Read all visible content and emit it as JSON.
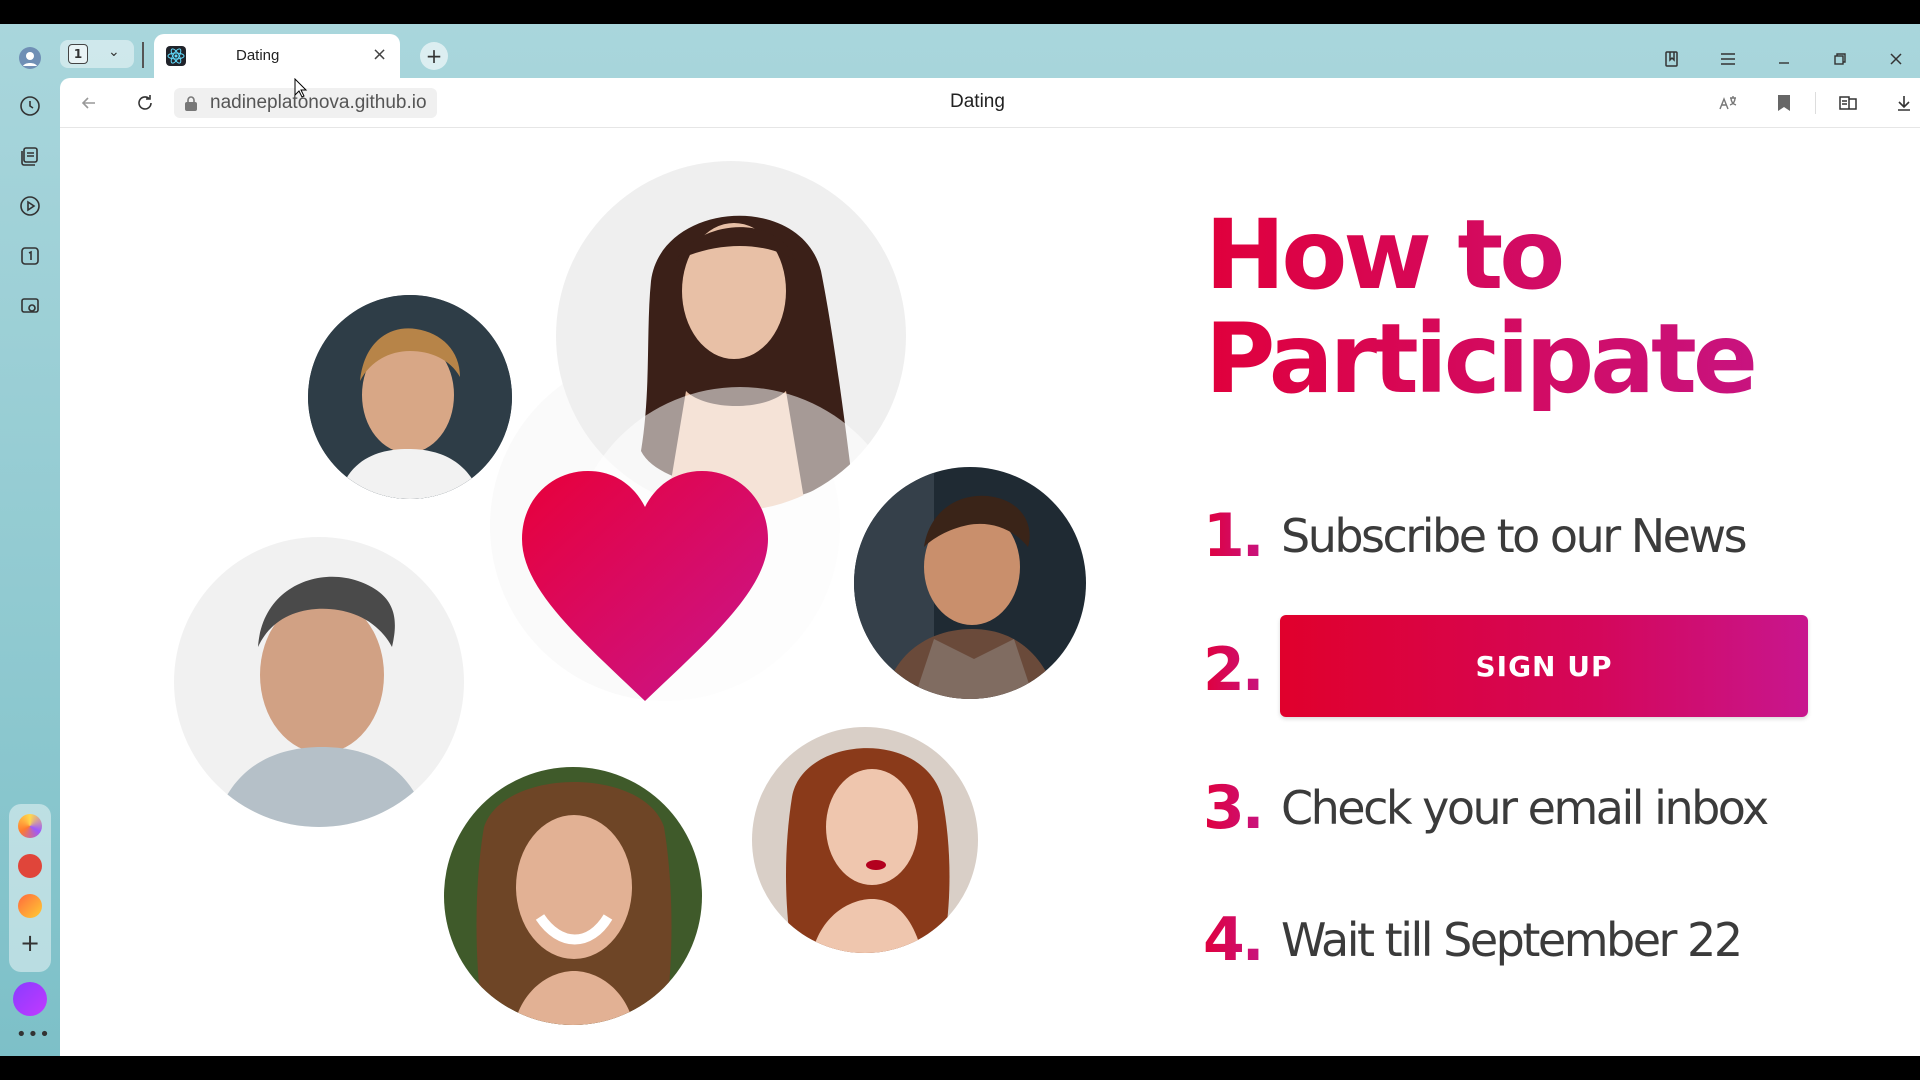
{
  "browser": {
    "tab_count": "1",
    "tab_title": "Dating",
    "url": "nadineplatonova.github.io",
    "page_title": "Dating"
  },
  "page": {
    "headline_line1": "How to",
    "headline_line2": "Participate",
    "steps": [
      {
        "number": "1.",
        "text": "Subscribe to our News"
      },
      {
        "number": "2.",
        "button_label": "SIGN UP"
      },
      {
        "number": "3.",
        "text": "Check your email inbox"
      },
      {
        "number": "4.",
        "text": "Wait till September 22"
      }
    ]
  },
  "colors": {
    "accent": "#d4145a",
    "accent_gradient_start": "#e0002c",
    "accent_gradient_end": "#c8168e",
    "chrome": "#8fc9d0",
    "body_text": "#3b3b3b"
  },
  "icons": {
    "sidebar": [
      "history-icon",
      "collections-icon",
      "play-icon",
      "tab-one-icon",
      "screenshot-icon"
    ],
    "toolbar": [
      "back-arrow-icon",
      "reload-icon",
      "lock-icon",
      "translate-icon",
      "bookmark-icon",
      "reader-icon",
      "download-icon"
    ]
  }
}
